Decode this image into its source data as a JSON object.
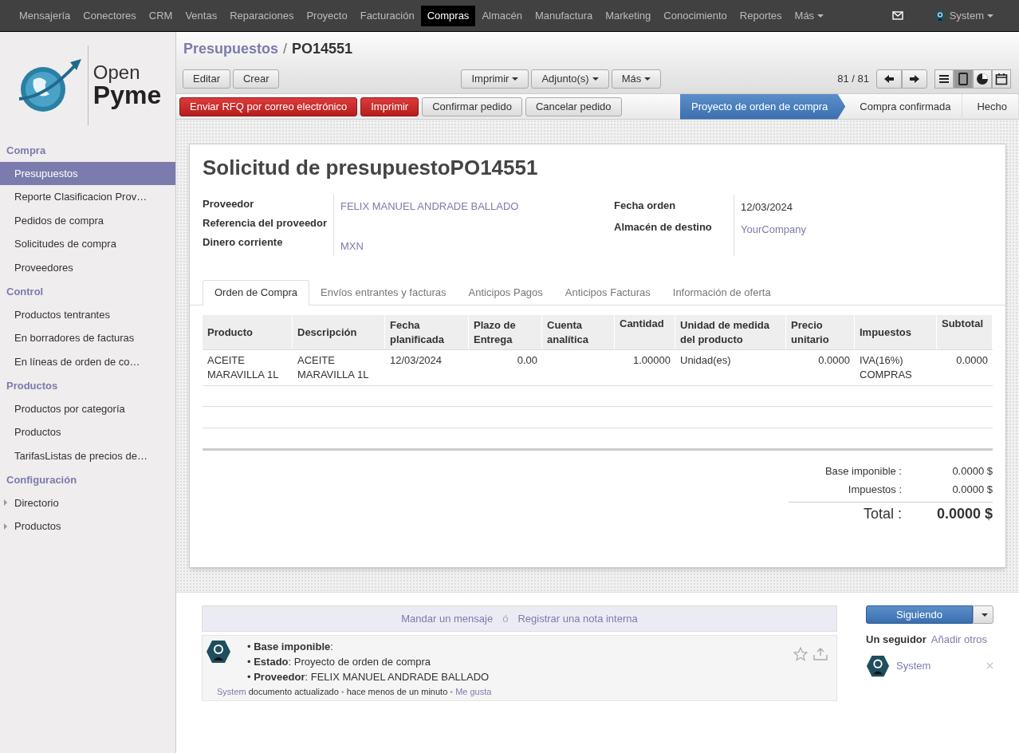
{
  "top_menu": {
    "items": [
      {
        "label": "Mensajería",
        "selected": false
      },
      {
        "label": "Conectores",
        "selected": false
      },
      {
        "label": "CRM",
        "selected": false
      },
      {
        "label": "Ventas",
        "selected": false
      },
      {
        "label": "Reparaciones",
        "selected": false
      },
      {
        "label": "Proyecto",
        "selected": false
      },
      {
        "label": "Facturación",
        "selected": false
      },
      {
        "label": "Compras",
        "selected": true
      },
      {
        "label": "Almacén",
        "selected": false
      },
      {
        "label": "Manufactura",
        "selected": false
      },
      {
        "label": "Marketing",
        "selected": false
      },
      {
        "label": "Conocimiento",
        "selected": false
      },
      {
        "label": "Reportes",
        "selected": false
      }
    ],
    "more": "Más",
    "user": "System"
  },
  "logo": {
    "line1": "Open",
    "line2": "Pyme"
  },
  "sidebar": [
    {
      "title": "Compra",
      "items": [
        {
          "label": "Presupuestos",
          "selected": true,
          "kind": "link"
        },
        {
          "label": "Reporte Clasificacion Prov…",
          "selected": false,
          "kind": "link"
        },
        {
          "label": "Pedidos de compra",
          "selected": false,
          "kind": "link"
        },
        {
          "label": "Solicitudes de compra",
          "selected": false,
          "kind": "link"
        },
        {
          "label": "Proveedores",
          "selected": false,
          "kind": "link"
        }
      ]
    },
    {
      "title": "Control",
      "items": [
        {
          "label": "Productos tentrantes",
          "selected": false,
          "kind": "link"
        },
        {
          "label": "En borradores de facturas",
          "selected": false,
          "kind": "link"
        },
        {
          "label": "En líneas de orden de co…",
          "selected": false,
          "kind": "link"
        }
      ]
    },
    {
      "title": "Productos",
      "items": [
        {
          "label": "Productos por categoría",
          "selected": false,
          "kind": "link"
        },
        {
          "label": "Productos",
          "selected": false,
          "kind": "link"
        },
        {
          "label": "TarifasListas de precios de…",
          "selected": false,
          "kind": "link"
        }
      ]
    },
    {
      "title": "Configuración",
      "items": [
        {
          "label": "Directorio",
          "selected": false,
          "kind": "folder"
        },
        {
          "label": "Productos",
          "selected": false,
          "kind": "folder"
        }
      ]
    }
  ],
  "breadcrumb": {
    "parent": "Presupuestos",
    "separator": "/",
    "current": "PO14551"
  },
  "toolbar": {
    "buttons": [
      "Editar",
      "Crear"
    ],
    "dropdowns": [
      "Imprimir",
      "Adjunto(s)",
      "Más"
    ],
    "pager": "81 / 81",
    "views": [
      {
        "kind": "list",
        "selected": false
      },
      {
        "kind": "form",
        "selected": true
      },
      {
        "kind": "graph",
        "selected": false
      },
      {
        "kind": "calendar",
        "selected": false
      }
    ]
  },
  "actions": [
    {
      "label": "Enviar RFQ por correo electrónico",
      "kind": "primary"
    },
    {
      "label": "Imprimir",
      "kind": "primary"
    },
    {
      "label": "Confirmar pedido",
      "kind": "default"
    },
    {
      "label": "Cancelar pedido",
      "kind": "default"
    }
  ],
  "status_steps": [
    {
      "label": "Proyecto de orden de compra",
      "selected": true
    },
    {
      "label": "Compra confirmada",
      "selected": false
    },
    {
      "label": "Hecho",
      "selected": false
    }
  ],
  "form": {
    "title": "Solicitud de presupuesto",
    "number": "PO14551",
    "left_fields": [
      {
        "label": "Proveedor",
        "value": "FELIX MANUEL ANDRADE BALLADO",
        "kind": "link"
      },
      {
        "label": "Referencia del proveedor"
      },
      {
        "label": "Dinero corriente",
        "value": "MXN",
        "kind": "link"
      }
    ],
    "right_fields": [
      {
        "label": "Fecha orden",
        "value": "12/03/2024",
        "kind": "text"
      },
      {
        "label": "Almacén de destino",
        "value": "YourCompany",
        "kind": "link"
      }
    ],
    "tabs": [
      {
        "label": "Orden de Compra",
        "selected": true
      },
      {
        "label": "Envíos entrantes y facturas",
        "selected": false
      },
      {
        "label": "Anticipos Pagos",
        "selected": false
      },
      {
        "label": "Anticipos Facturas",
        "selected": false
      },
      {
        "label": "Información de oferta",
        "selected": false
      }
    ],
    "table": {
      "columns": [
        {
          "label": "Producto",
          "numeric": false
        },
        {
          "label": "Descripción",
          "numeric": false
        },
        {
          "label": "Fecha planificada",
          "numeric": false
        },
        {
          "label": "Plazo de Entrega",
          "numeric": true
        },
        {
          "label": "Cuenta analítica"
        },
        {
          "label": "Cantidad",
          "numeric": true
        },
        {
          "label": "Unidad de medida del producto",
          "numeric": false
        },
        {
          "label": "Precio unitario",
          "numeric": true
        },
        {
          "label": "Impuestos",
          "numeric": false
        },
        {
          "label": "Subtotal",
          "numeric": true
        }
      ],
      "rows": [
        [
          "ACEITE MARAVILLA 1L",
          "ACEITE MARAVILLA 1L",
          "12/03/2024",
          "0.00",
          "",
          "1.00000",
          "Unidad(es)",
          "0.0000",
          "IVA(16%) COMPRAS",
          "0.0000"
        ]
      ]
    },
    "totals": [
      {
        "label": "Base imponible :",
        "value": "0.0000 $"
      },
      {
        "label": "Impuestos :",
        "value": "0.0000 $"
      }
    ],
    "total": {
      "label": "Total :",
      "value": "0.0000 $"
    }
  },
  "chatter": {
    "compose": {
      "message": "Mandar un mensaje",
      "or": "ó",
      "note": "Registrar una nota interna"
    },
    "message": {
      "lines": [
        "• **Base imponible**:",
        "• **Estado**: Proyecto de orden de compra",
        "• **Proveedor**: FELIX MANUEL ANDRADE BALLADO"
      ],
      "separator": "•",
      "author": "System",
      "text": "documento actualizado",
      "time": "hace menos de un minuto",
      "like": "Me gusta"
    },
    "follow_button": "Siguiendo",
    "followers_count": "Un seguidor",
    "add_followers": "Añadir otros",
    "followers": [
      {
        "name": "System"
      }
    ]
  }
}
